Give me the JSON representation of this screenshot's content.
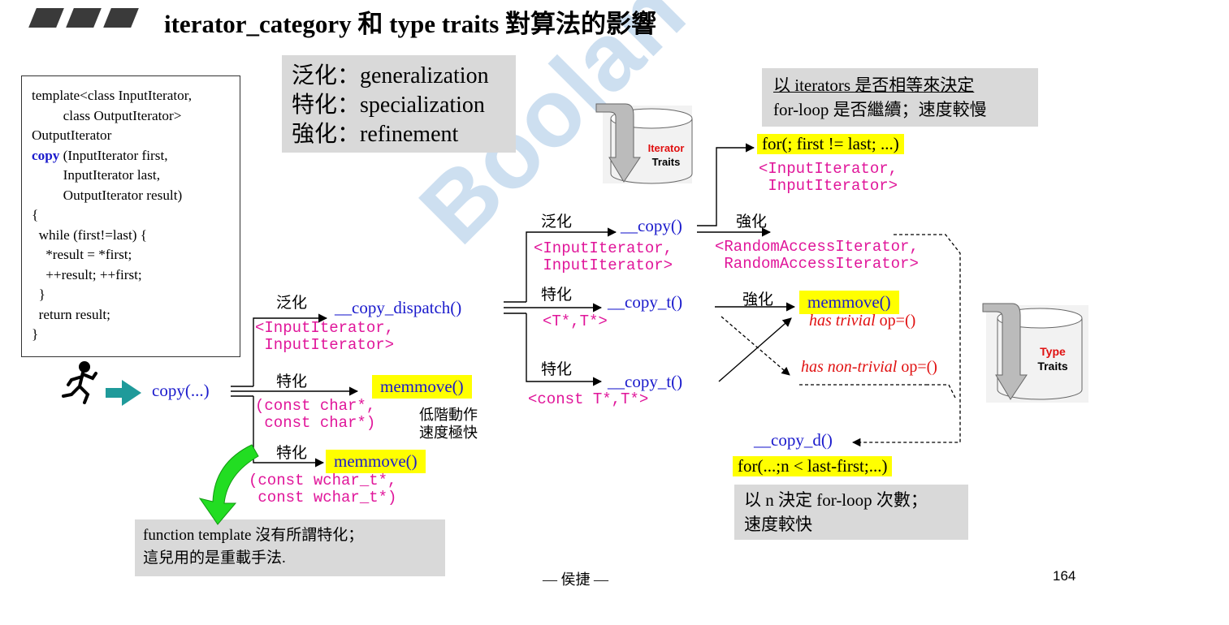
{
  "title": "iterator_category 和 type traits 對算法的影響",
  "code": {
    "lines": [
      "template<class InputIterator,",
      "         class OutputIterator>",
      "OutputIterator",
      "(InputIterator first,",
      "         InputIterator last,",
      "         OutputIterator result)",
      "{",
      "  while (first!=last) {",
      "    *result = *first;",
      "    ++result; ++first;",
      "  }",
      "  return result;",
      "}"
    ],
    "keyword": "copy"
  },
  "glossary": [
    "泛化：generalization",
    "特化：specialization",
    "強化：refinement"
  ],
  "note_iterators": [
    "以 iterators 是否相等來決定",
    "for-loop 是否繼續；速度較慢"
  ],
  "note_n": [
    "以 n 決定 for-loop 次數；",
    "速度較快"
  ],
  "note_overload": [
    "function template 沒有所謂特化；",
    "這兒用的是重載手法."
  ],
  "labels": {
    "generalization": "泛化",
    "specialization": "特化",
    "refinement": "強化",
    "low_level": [
      "低階動作",
      "速度極快"
    ]
  },
  "nodes": {
    "copy_call": "copy(...)",
    "copy_dispatch": "__copy_dispatch()",
    "copy_dispatch_types": [
      "<InputIterator,",
      " InputIterator>"
    ],
    "memmove_char": "memmove()",
    "char_types": [
      "(const char*,",
      " const char*)"
    ],
    "memmove_wchar": "memmove()",
    "wchar_types": [
      "(const wchar_t*,",
      " const wchar_t*)"
    ],
    "copy_inner": "__copy()",
    "copy_inner_types": [
      "<InputIterator,",
      " InputIterator>"
    ],
    "for_iter": "for(; first != last; ...)",
    "for_iter_types": [
      "<InputIterator,",
      " InputIterator>"
    ],
    "random_types": [
      "<RandomAccessIterator,",
      " RandomAccessIterator>"
    ],
    "copy_t_ptr": "__copy_t()",
    "copy_t_ptr_types": "<T*,T*>",
    "copy_t_const": "__copy_t()",
    "copy_t_const_types": "<const T*,T*>",
    "memmove_trivial": "memmove()",
    "trivial_prefix": "has trivial",
    "trivial_suffix": " op=()",
    "nontrivial_prefix": "has non-trivial",
    "nontrivial_suffix": " op=()",
    "copy_d": "__copy_d()",
    "for_n": "for(...;n < last-first;...)"
  },
  "iterator_traits": [
    "Iterator",
    "Traits"
  ],
  "type_traits": [
    "Type",
    "Traits"
  ],
  "footer": {
    "author": "— 侯捷 —",
    "page": "164"
  },
  "watermark": "Boolan 博览网",
  "colors": {
    "blue": "#1a1acc",
    "magenta": "#e0169a",
    "red": "#e01010",
    "highlight": "#ffff00",
    "note_bg": "#d9d9d9"
  }
}
